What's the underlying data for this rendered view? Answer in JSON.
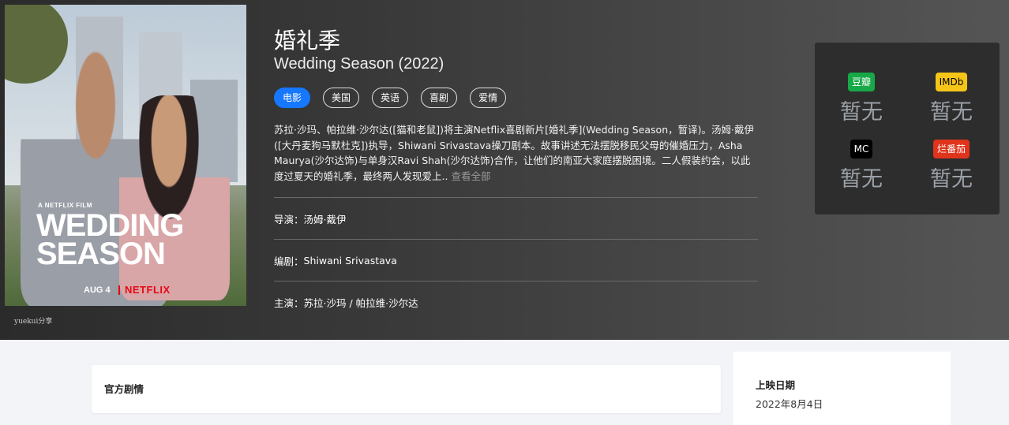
{
  "poster": {
    "film_label": "A NETFLIX FILM",
    "title_line1": "WEDDING",
    "title_line2": "SEASON",
    "date": "AUG 4",
    "brand": "NETFLIX"
  },
  "watermark": "yuekui分享",
  "title_cn": "婚礼季",
  "title_en": "Wedding Season (2022)",
  "tags": [
    {
      "label": "电影",
      "active": true
    },
    {
      "label": "美国",
      "active": false
    },
    {
      "label": "英语",
      "active": false
    },
    {
      "label": "喜剧",
      "active": false
    },
    {
      "label": "爱情",
      "active": false
    }
  ],
  "summary": {
    "text": "苏拉·沙玛、帕拉维·沙尔达([猫和老鼠])将主演Netflix喜剧新片[婚礼季](Wedding Season，暂译)。汤姆·戴伊([大丹麦狗马默杜克])执导，Shiwani Srivastava操刀剧本。故事讲述无法摆脱移民父母的催婚压力，Asha Maurya(沙尔达饰)与单身汉Ravi Shah(沙尔达饰)合作，让他们的南亚大家庭摆脱困境。二人假装约会，以此度过夏天的婚礼季，最终两人发现爱上..",
    "more": "查看全部"
  },
  "credits": [
    {
      "label": "导演：",
      "value": "汤姆·戴伊"
    },
    {
      "label": "编剧：",
      "value": "Shiwani Srivastava"
    },
    {
      "label": "主演：",
      "value": "苏拉·沙玛 / 帕拉维·沙尔达"
    }
  ],
  "ratings": [
    {
      "source": "豆瓣",
      "score": "暂无",
      "icon": "douban-badge",
      "color": "#17a847"
    },
    {
      "source": "IMDb",
      "score": "暂无",
      "icon": "imdb-badge",
      "color": "#f5c518"
    },
    {
      "source": "MC",
      "score": "暂无",
      "icon": "metacritic-badge",
      "color": "#000000"
    },
    {
      "source": "烂番茄",
      "score": "暂无",
      "icon": "rotten-tomatoes-badge",
      "color": "#e0341c"
    }
  ],
  "plot_section": {
    "heading": "官方剧情"
  },
  "side_info": {
    "release_label": "上映日期",
    "release_value": "2022年8月4日"
  },
  "colors": {
    "accent": "#1677ff"
  }
}
